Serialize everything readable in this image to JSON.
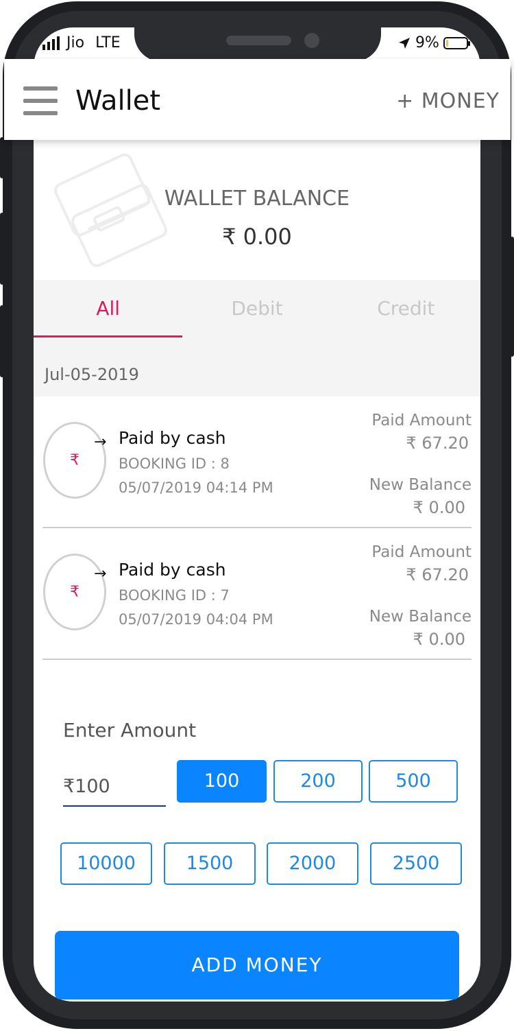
{
  "status_bar": {
    "carrier": "Jio",
    "network": "LTE",
    "battery": "9%",
    "battery_level": 0.09
  },
  "header": {
    "title": "Wallet",
    "add_money_label": "+ MONEY",
    "menu_icon": "hamburger-menu-icon"
  },
  "balance": {
    "label": "WALLET BALANCE",
    "value": "₹ 0.00"
  },
  "tabs": [
    {
      "label": "All",
      "active": true
    },
    {
      "label": "Debit",
      "active": false
    },
    {
      "label": "Credit",
      "active": false
    }
  ],
  "date_group": "Jul-05-2019",
  "transactions": [
    {
      "title": "Paid by cash",
      "booking": "BOOKING ID : 8",
      "datetime": "05/07/2019 04:14 PM",
      "paid_label": "Paid Amount",
      "paid_value": "₹ 67.20",
      "balance_label": "New Balance",
      "balance_value": "₹ 0.00",
      "icon": "rupee-icon"
    },
    {
      "title": "Paid by cash",
      "booking": "BOOKING ID : 7",
      "datetime": "05/07/2019 04:04 PM",
      "paid_label": "Paid Amount",
      "paid_value": "₹ 67.20",
      "balance_label": "New Balance",
      "balance_value": "₹ 0.00",
      "icon": "rupee-icon"
    }
  ],
  "add_money_form": {
    "label": "Enter Amount",
    "input_value": "₹100",
    "amount_options": [
      {
        "label": "100",
        "selected": true
      },
      {
        "label": "200",
        "selected": false
      },
      {
        "label": "500",
        "selected": false
      },
      {
        "label": "10000",
        "selected": false
      },
      {
        "label": "1500",
        "selected": false
      },
      {
        "label": "2000",
        "selected": false
      },
      {
        "label": "2500",
        "selected": false
      }
    ],
    "submit_label": "ADD MONEY"
  },
  "colors": {
    "accent": "#d81b60",
    "primary": "#0a84ff",
    "outline": "#1e88e5"
  }
}
